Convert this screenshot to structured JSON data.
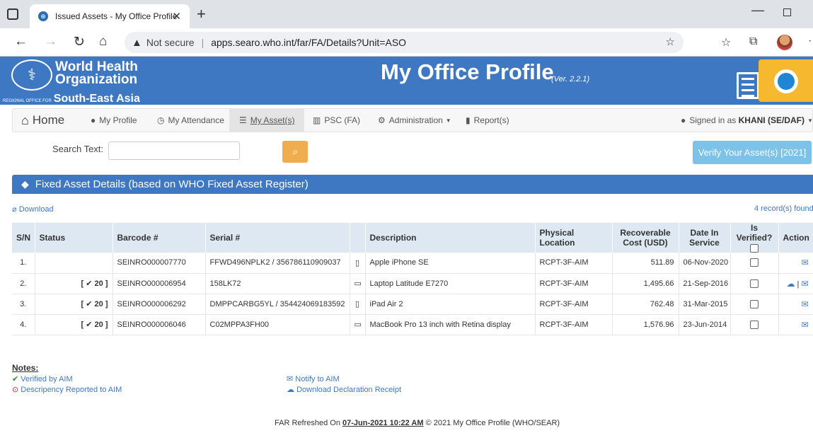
{
  "browser": {
    "tab_title": "Issued Assets - My Office Profile",
    "security_label": "Not secure",
    "url": "apps.searo.who.int/far/FA/Details?Unit=ASO"
  },
  "banner": {
    "org_line1": "World Health",
    "org_line2": "Organization",
    "region_small": "REGIONAL OFFICE FOR",
    "region": "South-East Asia",
    "app_title": "My Office Profile",
    "version": "(Ver. 2.2.1)"
  },
  "nav": {
    "home": "Home",
    "profile": "My Profile",
    "attendance": "My Attendance",
    "assets": "My Asset(s)",
    "psc": "PSC (FA)",
    "administration": "Administration",
    "reports": "Report(s)",
    "signed_in_prefix": "Signed in as",
    "signed_in_user": "KHANI (SE/DAF)"
  },
  "search": {
    "label": "Search Text:",
    "value": "",
    "verify_label": "Verify Your Asset(s) [2021]"
  },
  "panel": {
    "title": "Fixed Asset Details (based on WHO Fixed Asset Register)",
    "download": "Download",
    "records": "4 record(s) found"
  },
  "table": {
    "headers": {
      "sn": "S/N",
      "status": "Status",
      "barcode": "Barcode #",
      "serial": "Serial #",
      "description": "Description",
      "location": "Physical Location",
      "cost": "Recoverable Cost (USD)",
      "date": "Date In Service",
      "verified": "Is Verified?",
      "action": "Action"
    },
    "rows": [
      {
        "sn": "1.",
        "status": "",
        "barcode": "SEINRO000007770",
        "serial": "FFWD496NPLK2 / 356786110909037",
        "device": "phone-icon",
        "description": "Apple iPhone SE",
        "location": "RCPT-3F-AIM",
        "cost": "511.89",
        "date": "06-Nov-2020"
      },
      {
        "sn": "2.",
        "status": "[ ✔ 20 ]",
        "barcode": "SEINRO000006954",
        "serial": "158LK72",
        "device": "laptop-icon",
        "description": "Laptop Latitude E7270",
        "location": "RCPT-3F-AIM",
        "cost": "1,495.66",
        "date": "21-Sep-2016"
      },
      {
        "sn": "3.",
        "status": "[ ✔ 20 ]",
        "barcode": "SEINRO000006292",
        "serial": "DMPPCARBG5YL / 354424069183592",
        "device": "tablet-icon",
        "description": "iPad Air 2",
        "location": "RCPT-3F-AIM",
        "cost": "762.48",
        "date": "31-Mar-2015"
      },
      {
        "sn": "4.",
        "status": "[ ✔ 20 ]",
        "barcode": "SEINRO000006046",
        "serial": "C02MPPA3FH00",
        "device": "laptop-icon",
        "description": "MacBook Pro 13 inch with Retina display",
        "location": "RCPT-3F-AIM",
        "cost": "1,576.96",
        "date": "23-Jun-2014"
      }
    ]
  },
  "notes": {
    "title": "Notes:",
    "verified": "Verified by AIM",
    "discrepancy": "Descripency Reported to AIM",
    "notify": "Notify to AIM",
    "declaration": "Download Declaration Receipt"
  },
  "footer": {
    "prefix": "FAR Refreshed On",
    "date": "07-Jun-2021 10:22 AM",
    "suffix": "© 2021 My Office Profile (WHO/SEAR)"
  },
  "colors": {
    "brand_blue": "#3f78c2",
    "search_orange": "#f0ad4e",
    "verify_blue": "#7dc2e8",
    "verified_green": "#2e8b2e"
  }
}
